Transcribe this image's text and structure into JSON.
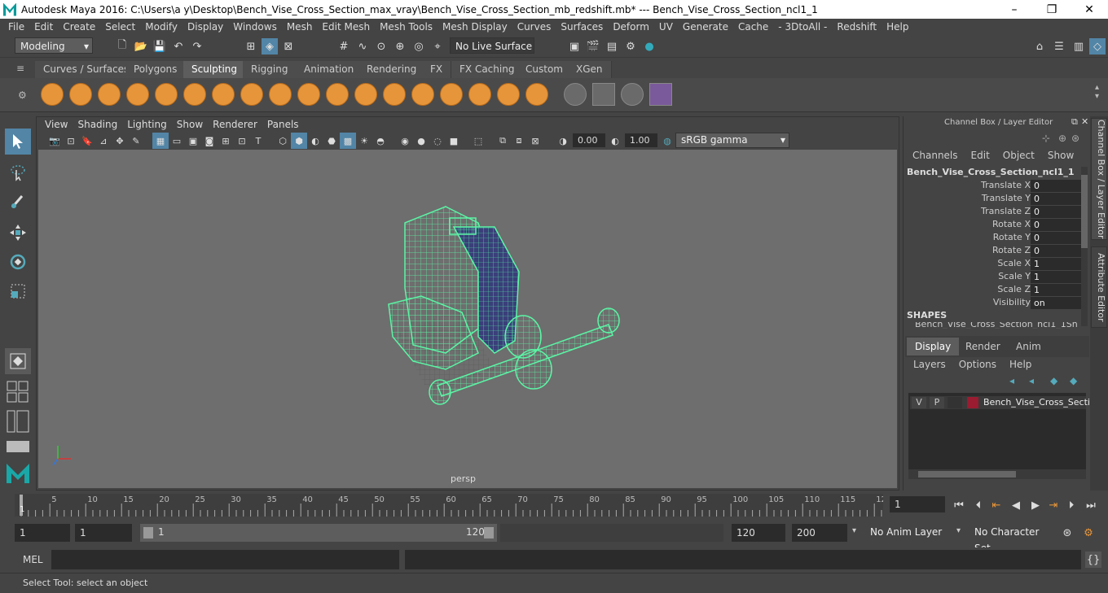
{
  "window": {
    "title": "Autodesk Maya 2016: C:\\Users\\a y\\Desktop\\Bench_Vise_Cross_Section_max_vray\\Bench_Vise_Cross_Section_mb_redshift.mb*   ---   Bench_Vise_Cross_Section_ncl1_1",
    "minimize": "–",
    "maximize": "❐",
    "close": "✕"
  },
  "menubar": [
    "File",
    "Edit",
    "Create",
    "Select",
    "Modify",
    "Display",
    "Windows",
    "Mesh",
    "Edit Mesh",
    "Mesh Tools",
    "Mesh Display",
    "Curves",
    "Surfaces",
    "Deform",
    "UV",
    "Generate",
    "Cache",
    "- 3DtoAll -",
    "Redshift",
    "Help"
  ],
  "status": {
    "mode": "Modeling",
    "live_surface": "No Live Surface"
  },
  "shelf_tabs": [
    "Curves / Surfaces",
    "Polygons",
    "Sculpting",
    "Rigging",
    "Animation",
    "Rendering",
    "FX",
    "FX Caching",
    "Custom",
    "XGen"
  ],
  "shelf_active": "Sculpting",
  "panel": {
    "menu": [
      "View",
      "Shading",
      "Lighting",
      "Show",
      "Renderer",
      "Panels"
    ],
    "exposure": "0.00",
    "gamma": "1.00",
    "colorspace": "sRGB gamma",
    "camera": "persp"
  },
  "channelbox": {
    "header": "Channel Box / Layer Editor",
    "menu": [
      "Channels",
      "Edit",
      "Object",
      "Show"
    ],
    "object": "Bench_Vise_Cross_Section_ncl1_1",
    "attrs": [
      {
        "name": "Translate X",
        "value": "0"
      },
      {
        "name": "Translate Y",
        "value": "0"
      },
      {
        "name": "Translate Z",
        "value": "0"
      },
      {
        "name": "Rotate X",
        "value": "0"
      },
      {
        "name": "Rotate Y",
        "value": "0"
      },
      {
        "name": "Rotate Z",
        "value": "0"
      },
      {
        "name": "Scale X",
        "value": "1"
      },
      {
        "name": "Scale Y",
        "value": "1"
      },
      {
        "name": "Scale Z",
        "value": "1"
      },
      {
        "name": "Visibility",
        "value": "on"
      }
    ],
    "shapes_label": "SHAPES",
    "shape_name": "Bench_Vise_Cross_Section_ncl1_1Sh..."
  },
  "layers": {
    "tabs": [
      "Display",
      "Render",
      "Anim"
    ],
    "active_tab": "Display",
    "menu": [
      "Layers",
      "Options",
      "Help"
    ],
    "row": {
      "v": "V",
      "p": "P",
      "name": "Bench_Vise_Cross_Sectio",
      "color": "#9b1b30"
    }
  },
  "side_tabs": [
    "Channel Box / Layer Editor",
    "Attribute Editor"
  ],
  "timeline": {
    "ticks": [
      "5",
      "10",
      "15",
      "20",
      "25",
      "30",
      "35",
      "40",
      "45",
      "50",
      "55",
      "60",
      "65",
      "70",
      "75",
      "80",
      "85",
      "90",
      "95",
      "100",
      "105",
      "110",
      "115",
      "12"
    ],
    "start_tick": "1",
    "current_frame": "1"
  },
  "range": {
    "start": "1",
    "playback_start": "1",
    "slider_start": "1",
    "slider_end": "120",
    "playback_end": "120",
    "end": "200",
    "anim_layer": "No Anim Layer",
    "char_set": "No Character Set"
  },
  "mel": {
    "label": "MEL"
  },
  "helpline": "Select Tool: select an object",
  "colors": {
    "accent": "#5285a6",
    "shelf_icon": "#e6953a",
    "wire": "#5bf5a5"
  }
}
